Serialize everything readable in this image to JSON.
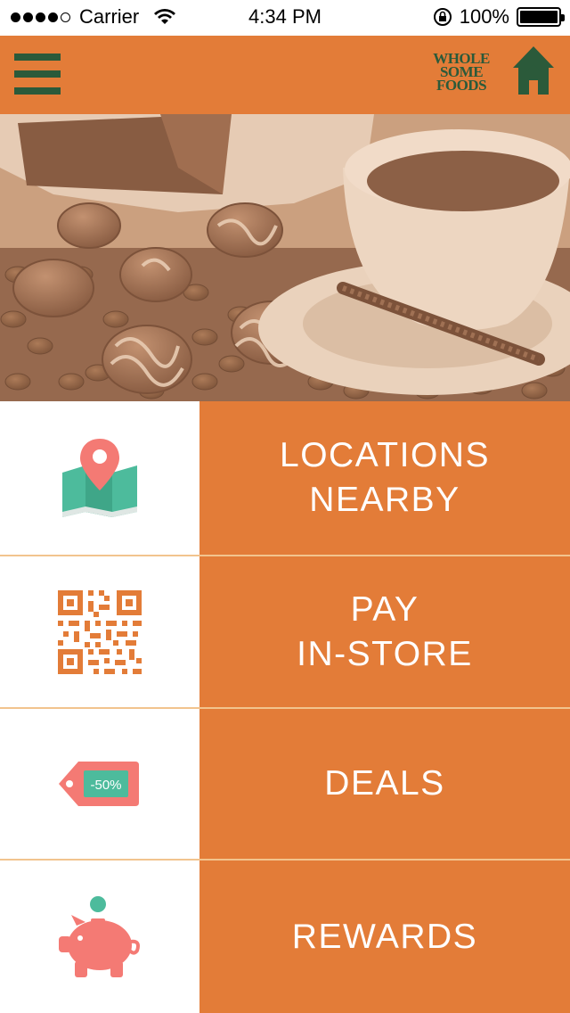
{
  "status_bar": {
    "carrier": "Carrier",
    "time": "4:34 PM",
    "battery": "100%",
    "signal_bars_filled": 4,
    "signal_bars_total": 5
  },
  "nav": {
    "menu_icon": "hamburger-menu-icon",
    "brand_line1": "WHOLE",
    "brand_line2": "SOME",
    "brand_line3": "FOODS",
    "home_icon": "home-icon"
  },
  "hero": {
    "image": "coffee-cup-and-chocolates-photo"
  },
  "menu": [
    {
      "line1": "LOCATIONS",
      "line2": "NEARBY",
      "icon": "map-pin-icon"
    },
    {
      "line1": "PAY",
      "line2": "IN-STORE",
      "icon": "qr-code-icon"
    },
    {
      "line1": "DEALS",
      "line2": "",
      "icon": "price-tag-icon",
      "tag_text": "-50%"
    },
    {
      "line1": "REWARDS",
      "line2": "",
      "icon": "piggy-bank-icon"
    }
  ],
  "colors": {
    "accent_orange": "#e37c38",
    "brand_green": "#2b5a3a",
    "teal": "#4dbb9c",
    "coral": "#f47a74",
    "divider": "#f2c48e"
  }
}
